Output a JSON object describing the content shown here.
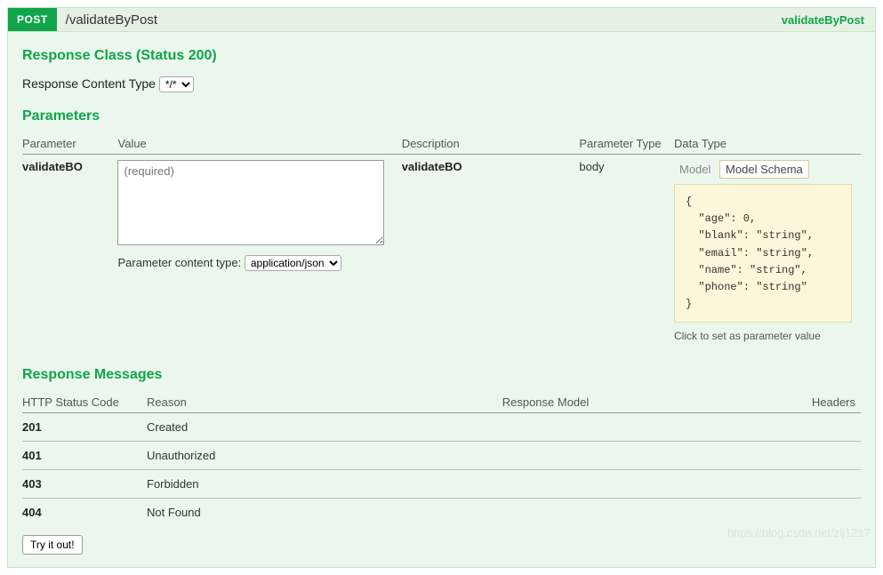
{
  "header": {
    "method": "POST",
    "path": "/validateByPost",
    "operation": "validateByPost"
  },
  "responseClass": {
    "title": "Response Class (Status 200)",
    "contentTypeLabel": "Response Content Type",
    "contentTypeValue": "*/*"
  },
  "parameters": {
    "title": "Parameters",
    "headers": {
      "parameter": "Parameter",
      "value": "Value",
      "description": "Description",
      "paramType": "Parameter Type",
      "dataType": "Data Type"
    },
    "row": {
      "name": "validateBO",
      "valuePlaceholder": "(required)",
      "contentTypeLabel": "Parameter content type:",
      "contentTypeValue": "application/json",
      "description": "validateBO",
      "paramType": "body",
      "tabs": {
        "model": "Model",
        "schema": "Model Schema"
      },
      "schema": "{\n  \"age\": 0,\n  \"blank\": \"string\",\n  \"email\": \"string\",\n  \"name\": \"string\",\n  \"phone\": \"string\"\n}",
      "setHint": "Click to set as parameter value"
    }
  },
  "responseMessages": {
    "title": "Response Messages",
    "headers": {
      "code": "HTTP Status Code",
      "reason": "Reason",
      "model": "Response Model",
      "hdrs": "Headers"
    },
    "rows": [
      {
        "code": "201",
        "reason": "Created"
      },
      {
        "code": "401",
        "reason": "Unauthorized"
      },
      {
        "code": "403",
        "reason": "Forbidden"
      },
      {
        "code": "404",
        "reason": "Not Found"
      }
    ]
  },
  "tryBtn": "Try it out!",
  "watermark": "https://blog.csdn.net/zlj1217"
}
